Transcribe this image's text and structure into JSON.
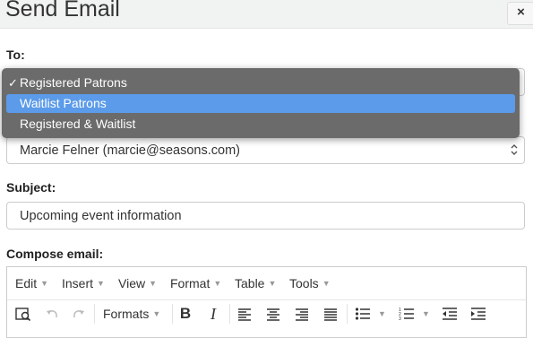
{
  "dialog": {
    "title": "Send Email",
    "close_label": "×"
  },
  "to": {
    "label": "To:",
    "options": [
      {
        "label": "Registered Patrons",
        "checked": true
      },
      {
        "label": "Waitlist Patrons",
        "highlighted": true
      },
      {
        "label": "Registered & Waitlist"
      }
    ],
    "check_mark": "✓"
  },
  "from": {
    "value": "Marcie Felner (marcie@seasons.com)"
  },
  "subject": {
    "label": "Subject:",
    "value": "Upcoming event information"
  },
  "compose": {
    "label": "Compose email:",
    "menu": [
      "Edit",
      "Insert",
      "View",
      "Format",
      "Table",
      "Tools"
    ],
    "toolbar": {
      "formats_label": "Formats",
      "bold": "B",
      "italic": "I"
    }
  },
  "colors": {
    "highlight": "#5b9be9",
    "dropdown_bg": "#6b6b6b"
  }
}
